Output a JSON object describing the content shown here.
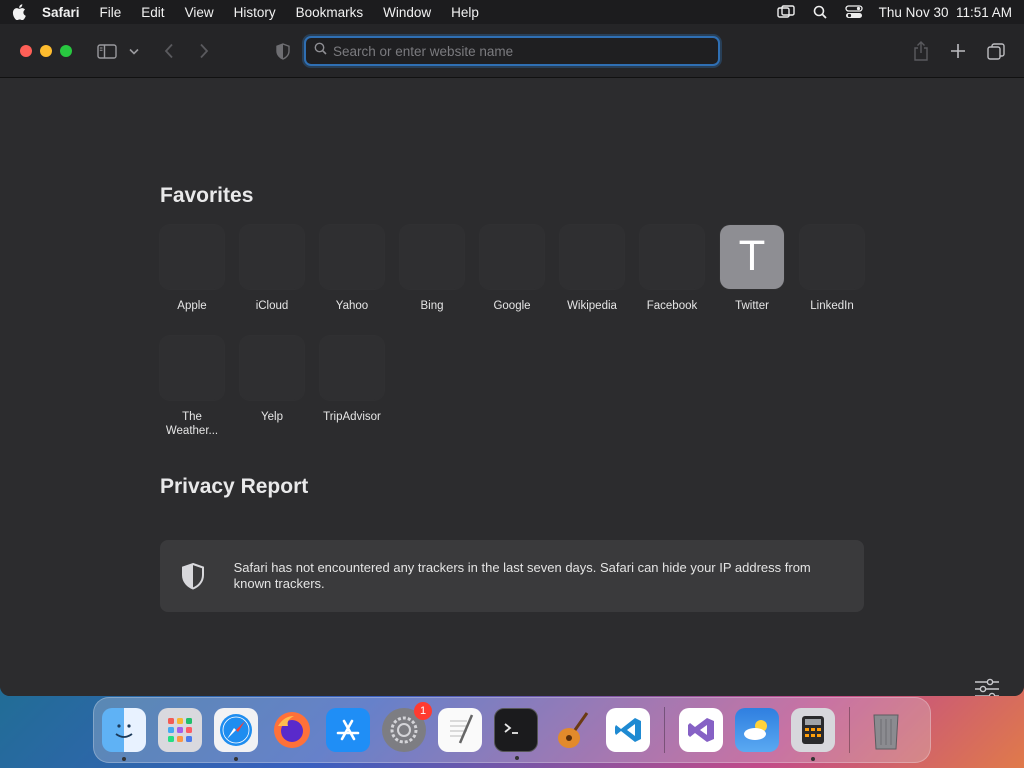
{
  "menubar": {
    "app": "Safari",
    "items": [
      "File",
      "Edit",
      "View",
      "History",
      "Bookmarks",
      "Window",
      "Help"
    ],
    "clock": "Thu Nov 30  11:51 AM"
  },
  "toolbar": {
    "search_placeholder": "Search or enter website name",
    "search_value": ""
  },
  "favorites": {
    "title": "Favorites",
    "items": [
      {
        "label": "Apple"
      },
      {
        "label": "iCloud"
      },
      {
        "label": "Yahoo"
      },
      {
        "label": "Bing"
      },
      {
        "label": "Google"
      },
      {
        "label": "Wikipedia"
      },
      {
        "label": "Facebook"
      },
      {
        "label": "Twitter",
        "letter": "T"
      },
      {
        "label": "LinkedIn"
      },
      {
        "label": "The Weather..."
      },
      {
        "label": "Yelp"
      },
      {
        "label": "TripAdvisor"
      }
    ]
  },
  "privacy": {
    "title": "Privacy Report",
    "message": "Safari has not encountered any trackers in the last seven days. Safari can hide your IP address from known trackers."
  },
  "dock": {
    "apps": [
      {
        "name": "finder",
        "running": true
      },
      {
        "name": "launchpad"
      },
      {
        "name": "safari",
        "running": true
      },
      {
        "name": "firefox"
      },
      {
        "name": "app-store"
      },
      {
        "name": "system-settings",
        "badge": "1"
      },
      {
        "name": "textedit"
      },
      {
        "name": "terminal",
        "running": true
      },
      {
        "name": "garageband"
      },
      {
        "name": "vscode"
      },
      {
        "name": "visual-studio"
      },
      {
        "name": "weather"
      },
      {
        "name": "calculator",
        "running": true
      },
      {
        "name": "trash"
      }
    ]
  },
  "colors": {
    "accent": "#2f6fb3",
    "window_bg": "#2c2c2e",
    "badge": "#ff3b30"
  }
}
